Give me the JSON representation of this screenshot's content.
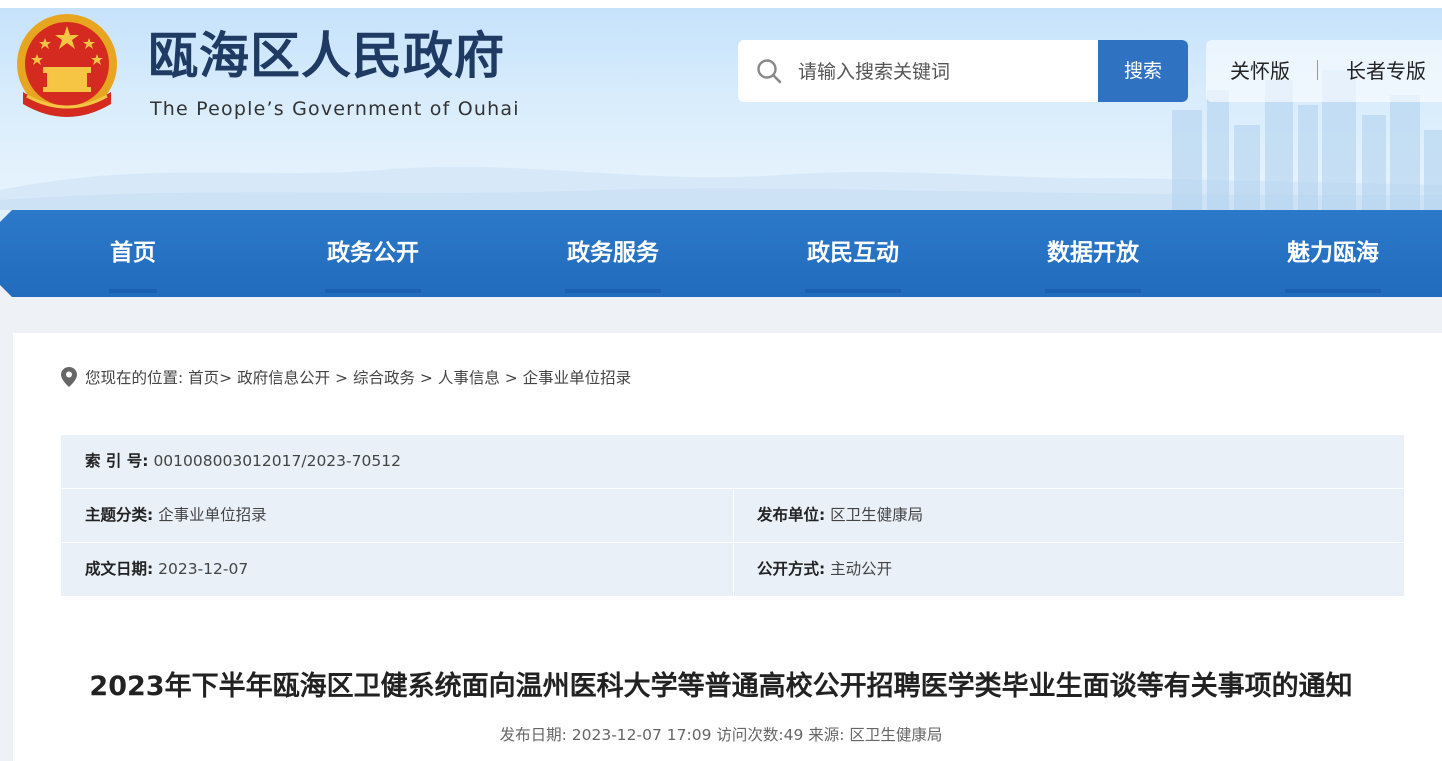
{
  "header": {
    "site_title": "瓯海区人民政府",
    "site_subtitle": "The People’s Government of Ouhai",
    "search": {
      "placeholder": "请输入搜索关键词",
      "button_label": "搜索"
    },
    "care_version_label": "关怀版",
    "elder_version_label": "长者专版"
  },
  "nav": {
    "items": [
      {
        "label": "首页"
      },
      {
        "label": "政务公开"
      },
      {
        "label": "政务服务"
      },
      {
        "label": "政民互动"
      },
      {
        "label": "数据开放"
      },
      {
        "label": "魅力瓯海"
      }
    ]
  },
  "breadcrumb": {
    "prefix": "您现在的位置: ",
    "items": [
      "首页",
      "政府信息公开",
      "综合政务",
      "人事信息",
      "企事业单位招录"
    ]
  },
  "info_table": {
    "index_label": "索 引 号:",
    "index_value": "001008003012017/2023-70512",
    "topic_label": "主题分类:",
    "topic_value": "企事业单位招录",
    "publisher_label": "发布单位:",
    "publisher_value": "区卫生健康局",
    "date_label": "成文日期:",
    "date_value": "2023-12-07",
    "disclosure_label": "公开方式:",
    "disclosure_value": "主动公开"
  },
  "article": {
    "title": "2023年下半年瓯海区卫健系统面向温州医科大学等普通高校公开招聘医学类毕业生面谈等有关事项的通知",
    "meta": "发布日期: 2023-12-07 17:09 访问次数:49 来源: 区卫生健康局"
  },
  "colors": {
    "nav_bg": "#2272c3",
    "search_button": "#2f72c2",
    "title_text": "#1f3b63",
    "info_bg": "#e9f0f8"
  }
}
